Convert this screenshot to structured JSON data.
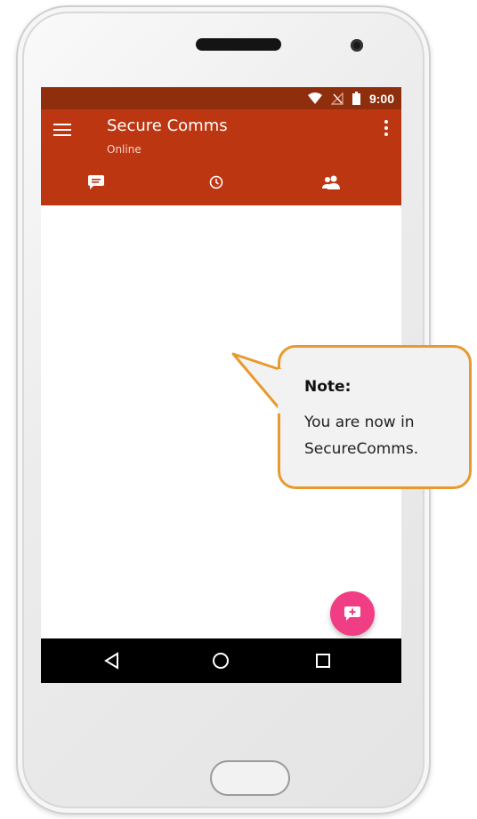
{
  "status_bar": {
    "time": "9:00",
    "icons": [
      "wifi-icon",
      "no-signal-icon",
      "battery-icon"
    ]
  },
  "app_bar": {
    "title": "Secure Comms",
    "subtitle": "Online",
    "menu_icon": "hamburger-menu-icon",
    "overflow_icon": "more-vert-icon"
  },
  "tabs": [
    {
      "icon": "chat-icon"
    },
    {
      "icon": "clock-icon"
    },
    {
      "icon": "contacts-icon"
    }
  ],
  "fab": {
    "icon": "new-chat-icon"
  },
  "nav_bar": {
    "buttons": [
      "back-icon",
      "home-icon",
      "recents-icon"
    ]
  },
  "callout": {
    "title": "Note:",
    "body": "You are now in SecureComms."
  },
  "colors": {
    "status_bar": "#8e2e0d",
    "app_bar": "#bd3612",
    "fab": "#f03d83",
    "callout_border": "#e89a2e",
    "callout_fill": "#f2f2f2"
  }
}
